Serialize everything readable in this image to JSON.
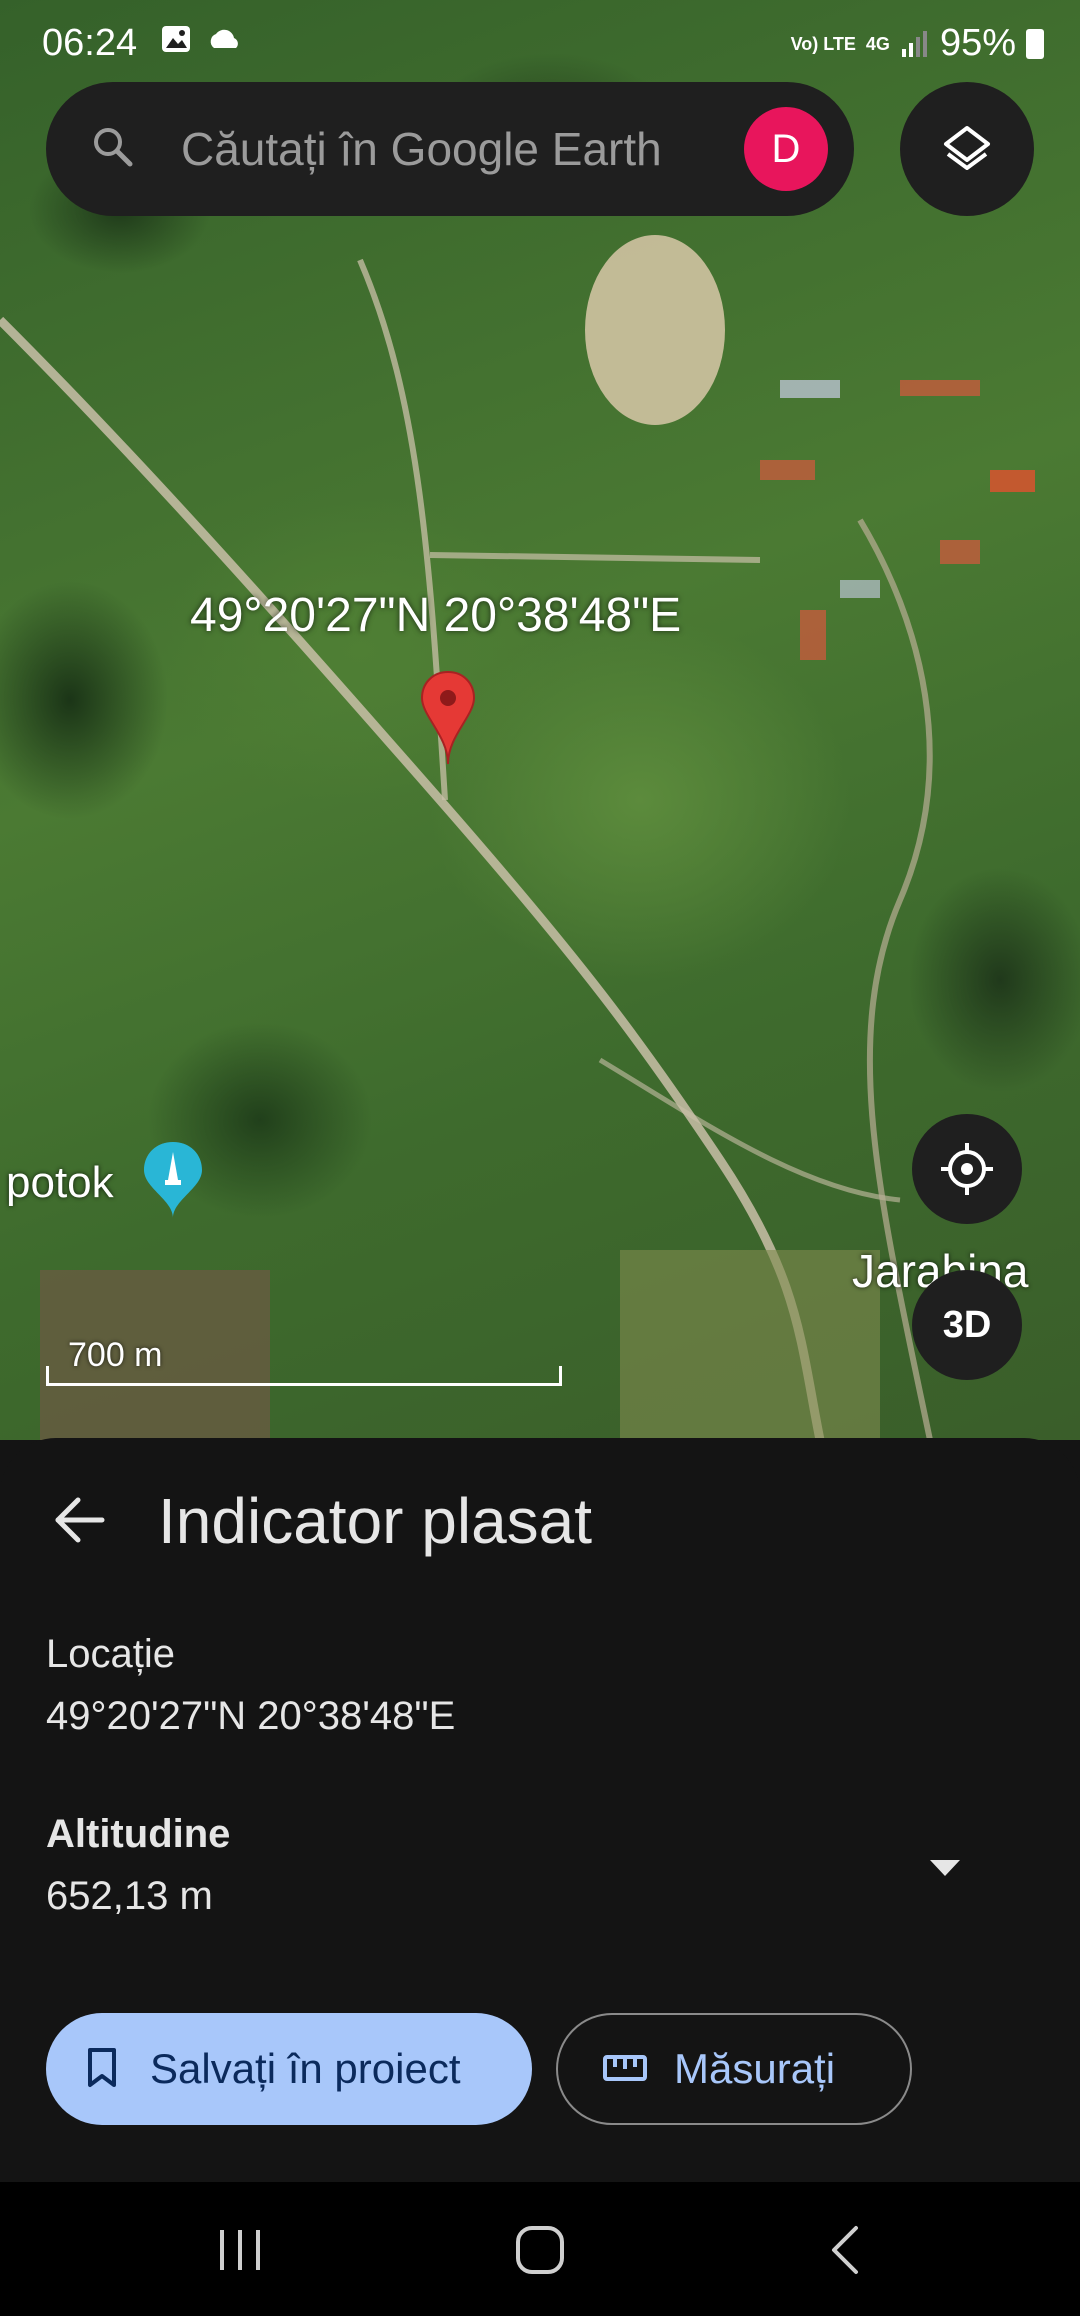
{
  "status_bar": {
    "time": "06:24",
    "network_top": "4G",
    "volte": "Vo) LTE",
    "battery": "95%"
  },
  "search": {
    "placeholder": "Căutați în Google Earth",
    "avatar_letter": "D"
  },
  "map": {
    "pin_coordinates": "49°20'27\"N 20°38'48\"E",
    "place_label": "potok",
    "town_label": "Jarabina",
    "scale_label": "700 m",
    "button_3d": "3D"
  },
  "sheet": {
    "title": "Indicator plasat",
    "location_label": "Locație",
    "location_value": "49°20'27\"N 20°38'48\"E",
    "altitude_label": "Altitudine",
    "altitude_value": "652,13 m",
    "save_button": "Salvați în proiect",
    "measure_button": "Măsurați"
  },
  "colors": {
    "avatar": "#e8155c",
    "pin": "#e53935",
    "primary_button": "#a8c7fa",
    "place_pin": "#29b6d6"
  },
  "icons": [
    "search-icon",
    "layers-icon",
    "map-pin-icon",
    "place-pin-icon",
    "locate-icon",
    "back-arrow-icon",
    "chevron-down-icon",
    "bookmark-icon",
    "ruler-icon",
    "nav-recent-icon",
    "nav-home-icon",
    "nav-back-icon"
  ]
}
